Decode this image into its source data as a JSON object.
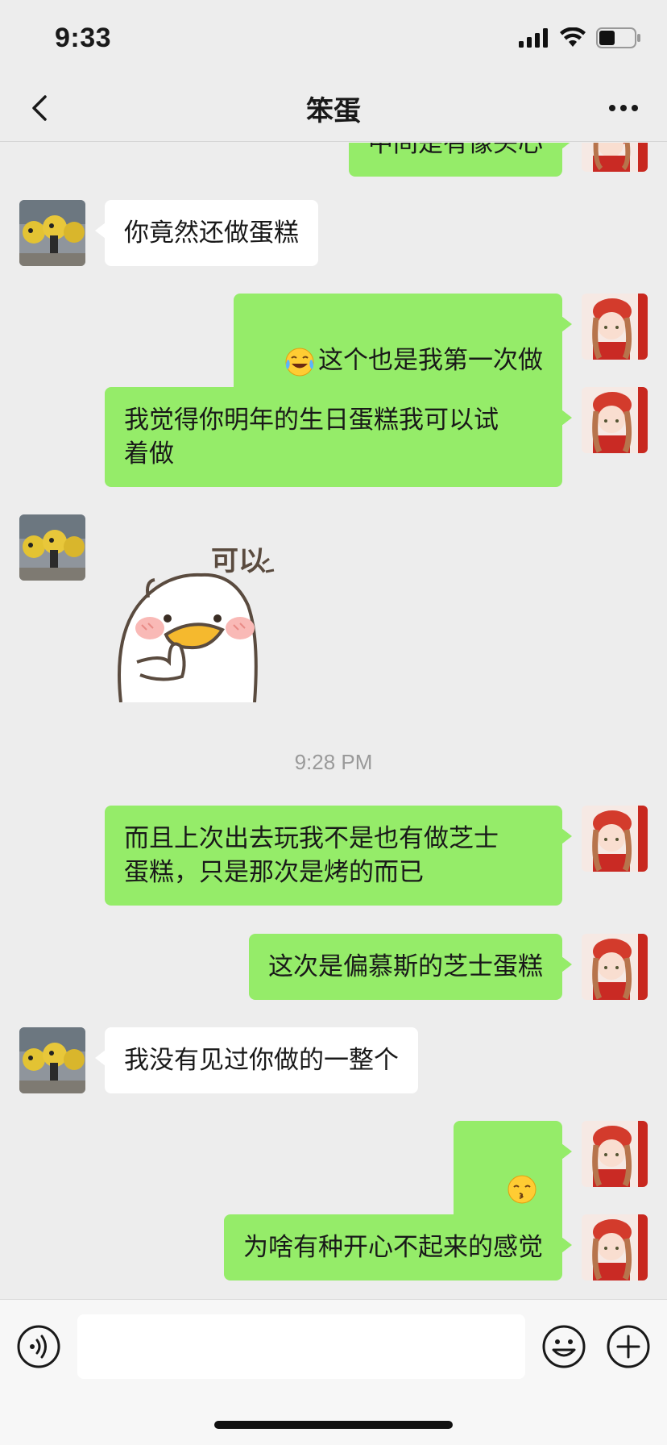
{
  "status_bar": {
    "time": "9:33",
    "battery_level": 0.45
  },
  "header": {
    "title": "笨蛋"
  },
  "messages": [
    {
      "side": "out",
      "text": "中间是有像头心"
    },
    {
      "side": "in",
      "text": "你竟然还做蛋糕"
    },
    {
      "side": "out",
      "emoji": "tears-of-joy-emoji",
      "text": "这个也是我第一次做"
    },
    {
      "side": "out",
      "text": "我觉得你明年的生日蛋糕我可以试\n着做"
    },
    {
      "side": "in",
      "type": "sticker",
      "sticker_text": "可以"
    },
    {
      "type": "timestamp",
      "text": "9:28 PM"
    },
    {
      "side": "out",
      "text": "而且上次出去玩我不是也有做芝士\n蛋糕，只是那次是烤的而已"
    },
    {
      "side": "out",
      "text": "这次是偏慕斯的芝士蛋糕"
    },
    {
      "side": "in",
      "text": "我没有见过你做的一整个"
    },
    {
      "side": "out",
      "emoji": "kissing-emoji",
      "text": ""
    },
    {
      "side": "out",
      "text": "为啥有种开心不起来的感觉"
    }
  ],
  "colors": {
    "background": "#ededed",
    "outgoing_bubble": "#95ec69",
    "incoming_bubble": "#ffffff",
    "timestamp_text": "#9a9a9a"
  },
  "input": {
    "value": "",
    "placeholder": ""
  }
}
